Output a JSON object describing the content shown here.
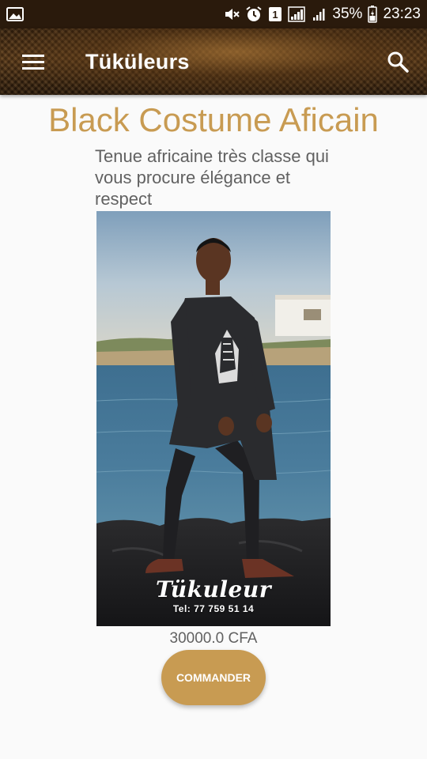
{
  "status_bar": {
    "battery": "35%",
    "time": "23:23",
    "sim_badge": "1",
    "icons": [
      "gallery-icon",
      "mute-icon",
      "alarm-icon",
      "sim-icon",
      "signal-icon",
      "signal-icon",
      "battery-icon"
    ]
  },
  "app_bar": {
    "title": "Tüküleurs",
    "menu_icon": "hamburger-menu-icon",
    "search_icon": "search-icon"
  },
  "product": {
    "title": "Black Costume Aficain",
    "description": "Tenue africaine très classe qui vous procure élégance et respect",
    "image_brand": "Tükuleur",
    "image_phone": "Tel: 77 759 51 14",
    "price": "30000.0 CFA",
    "order_label": "COMMANDER"
  },
  "colors": {
    "accent": "#c89b52",
    "text_secondary": "#616161",
    "background": "#fafafa",
    "app_bar": "#3a2410"
  }
}
